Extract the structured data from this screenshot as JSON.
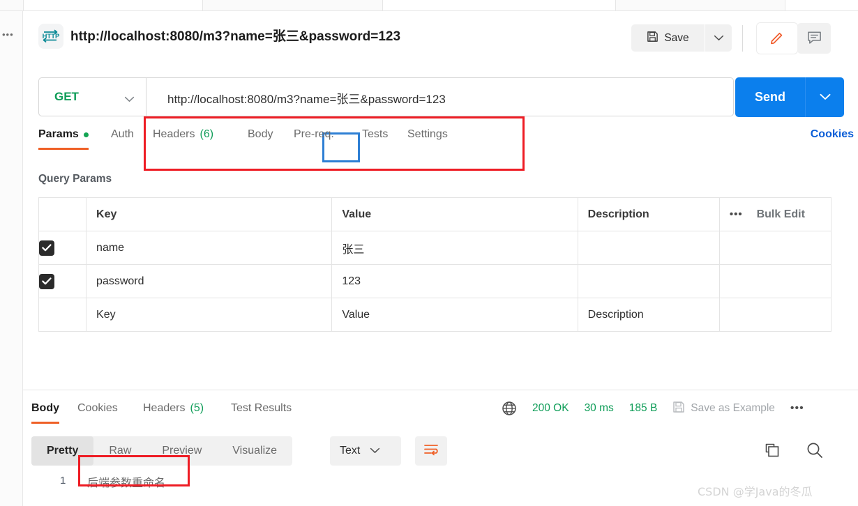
{
  "window": {
    "request_title": "http://localhost:8080/m3?name=张三&password=123",
    "http_badge_label": "HTTP"
  },
  "header": {
    "save_label": "Save",
    "save_icon": "floppy-disk-icon",
    "save_caret_icon": "chevron-down-icon",
    "edit_icon": "pencil-icon",
    "comment_icon": "comment-icon"
  },
  "request_bar": {
    "method": "GET",
    "method_caret_icon": "chevron-down-icon",
    "url": "http://localhost:8080/m3?name=张三&password=123",
    "send_label": "Send",
    "send_caret_icon": "chevron-down-icon",
    "accent_color": "#0b7fed",
    "method_color": "#0f9d58"
  },
  "request_tabs": {
    "items": [
      {
        "label": "Params",
        "active": true,
        "dot": true
      },
      {
        "label": "Auth",
        "active": false
      },
      {
        "label": "Headers",
        "count": "(6)",
        "active": false
      },
      {
        "label": "Body",
        "active": false
      },
      {
        "label": "Pre-req.",
        "active": false
      },
      {
        "label": "Tests",
        "active": false
      },
      {
        "label": "Settings",
        "active": false
      }
    ],
    "cookies_link": "Cookies",
    "active_underline_color": "#ef6027"
  },
  "query_params": {
    "section_label": "Query Params",
    "columns": {
      "key": "Key",
      "value": "Value",
      "description": "Description"
    },
    "bulk_edit_label": "Bulk Edit",
    "bulk_dots": "•••",
    "rows": [
      {
        "checked": true,
        "key": "name",
        "value": "张三",
        "description": ""
      },
      {
        "checked": true,
        "key": "password",
        "value": "123",
        "description": ""
      }
    ],
    "placeholder_row": {
      "key": "Key",
      "value": "Value",
      "description": "Description"
    }
  },
  "response_tabs": {
    "items": [
      {
        "label": "Body",
        "active": true
      },
      {
        "label": "Cookies",
        "active": false
      },
      {
        "label": "Headers",
        "count": "(5)",
        "active": false
      },
      {
        "label": "Test Results",
        "active": false
      }
    ]
  },
  "response_status": {
    "globe_icon": "globe-icon",
    "status": "200 OK",
    "time": "30 ms",
    "size": "185 B",
    "save_example_label": "Save as Example",
    "save_example_icon": "floppy-disk-icon",
    "more_dots": "•••",
    "status_color": "#0f9d58"
  },
  "body_toolbar": {
    "views": [
      {
        "label": "Pretty",
        "active": true
      },
      {
        "label": "Raw",
        "active": false
      },
      {
        "label": "Preview",
        "active": false
      },
      {
        "label": "Visualize",
        "active": false
      }
    ],
    "format": "Text",
    "format_caret_icon": "chevron-down-icon",
    "wrap_icon": "word-wrap-icon",
    "copy_icon": "copy-icon",
    "search_icon": "search-icon"
  },
  "response_body": {
    "line_number": "1",
    "line_text": "后端参数重命名"
  },
  "annotations": {
    "url_box_color": "#ee1c24",
    "name_box_color": "#2e7fd4",
    "body_box_color": "#ee1c24"
  },
  "watermark": "CSDN @学Java的冬瓜"
}
